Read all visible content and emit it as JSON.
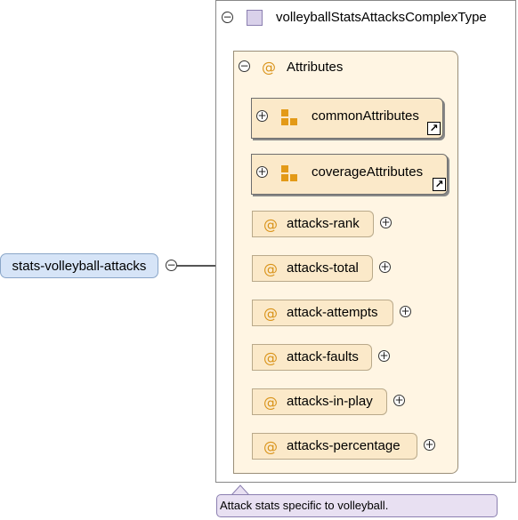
{
  "root_element": {
    "label": "stats-volleyball-attacks"
  },
  "complex_type": {
    "name": "volleyballStatsAttacksComplexType"
  },
  "attributes_group": {
    "title": "Attributes"
  },
  "attribute_group_refs": [
    {
      "label": "commonAttributes"
    },
    {
      "label": "coverageAttributes"
    }
  ],
  "attributes": [
    {
      "label": "attacks-rank"
    },
    {
      "label": "attacks-total"
    },
    {
      "label": "attack-attempts"
    },
    {
      "label": "attack-faults"
    },
    {
      "label": "attacks-in-play"
    },
    {
      "label": "attacks-percentage"
    }
  ],
  "annotation": {
    "text": "Attack stats specific to volleyball."
  },
  "glyphs": {
    "collapse": "−",
    "expand": "+",
    "at": "@",
    "link": "↗"
  },
  "colors": {
    "element_fill": "#d6e4f7",
    "attribute_fill": "#fbe9c9",
    "group_fill": "#fff5e3",
    "annotation_fill": "#e8e0f2",
    "icon_orange": "#e39a17"
  }
}
